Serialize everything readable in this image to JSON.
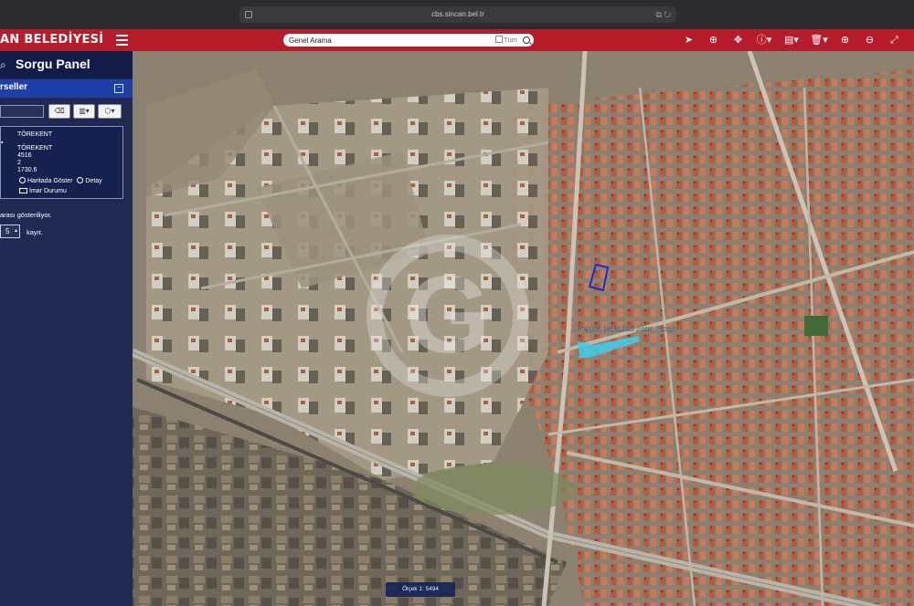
{
  "browser": {
    "url": "cbs.sincan.bel.tr"
  },
  "header": {
    "brand": "AN BELEDİYESİ",
    "search": {
      "placeholder": "Genel Arama",
      "value": "Genel Arama",
      "all_label": "Tüm"
    },
    "tools": [
      "cursor-arrow-icon",
      "globe-icon",
      "move-icon",
      "info-icon",
      "layers-icon",
      "trash-icon",
      "zoom-in-icon",
      "zoom-out-icon",
      "expand-icon"
    ]
  },
  "panel": {
    "title": "Sorgu Panel",
    "tab": "rseller",
    "result": {
      "header": "TÖREKENT",
      "district": "TÖREKENT",
      "ada": "4516",
      "parsel": "2",
      "area": "1730.6",
      "show_on_map": "Haritada Göster",
      "detail": "Detay",
      "zoning": "İmar Durumu"
    },
    "result_summary": "arası gösteriliyor.",
    "page_size": "5",
    "records_label": "kayıt."
  },
  "map": {
    "label": "Törekent Mahallesi Semt Pazarı",
    "watermark": "G",
    "scale_text": "Ölçek 1: 5494",
    "selection_color": "#1a2bd8",
    "highlight_color": "#41c9e8"
  },
  "colors": {
    "header": "#b71c2a",
    "panel": "#101c4e",
    "panel_tab": "#1f3fa8"
  }
}
